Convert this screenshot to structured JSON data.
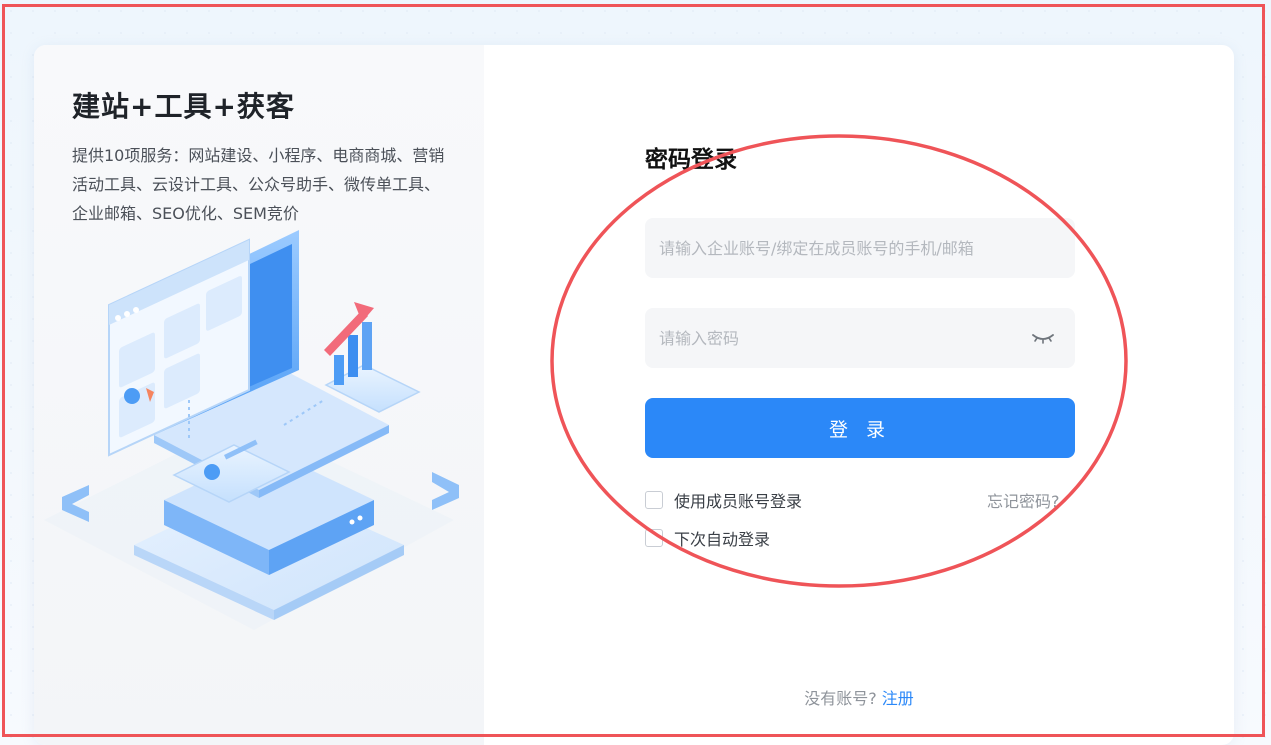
{
  "colors": {
    "accent": "#2b88f8",
    "annotation": "#ef5458",
    "headline": "#1f2329",
    "muted": "#8f949b"
  },
  "promo": {
    "headline": "建站+工具+获客",
    "description": "提供10项服务：网站建设、小程序、电商商城、营销活动工具、云设计工具、公众号助手、微传单工具、企业邮箱、SEO优化、SEM竞价"
  },
  "login": {
    "title": "密码登录",
    "account_placeholder": "请输入企业账号/绑定在成员账号的手机/邮箱",
    "account_value": "",
    "password_placeholder": "请输入密码",
    "password_value": "",
    "password_toggle_icon": "eye-closed-icon",
    "submit_label": "登 录",
    "member_login_label": "使用成员账号登录",
    "member_login_checked": false,
    "auto_login_label": "下次自动登录",
    "auto_login_checked": false,
    "forgot_label": "忘记密码?"
  },
  "signup": {
    "prompt": "没有账号?",
    "link_label": "注册"
  }
}
